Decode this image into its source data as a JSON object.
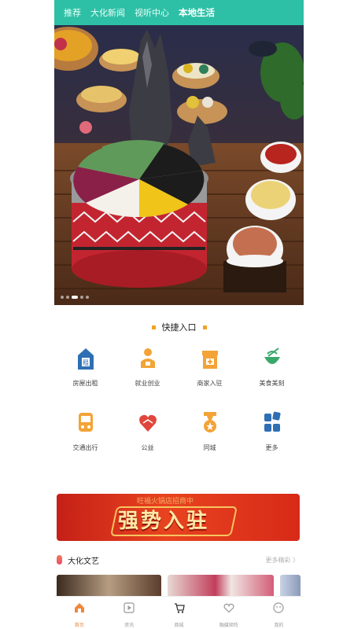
{
  "topnav": {
    "tabs": [
      "推荐",
      "大化新闻",
      "视听中心",
      "本地生活"
    ],
    "active_index": 3,
    "bg_color": "#2ec0a6"
  },
  "banner": {
    "dots_total": 5,
    "active_dot": 3
  },
  "quick_entry": {
    "title": "快捷入口",
    "items": [
      {
        "label": "房屋出租",
        "icon": "house-rent-icon"
      },
      {
        "label": "就业创业",
        "icon": "job-person-icon"
      },
      {
        "label": "商家入驻",
        "icon": "store-join-icon"
      },
      {
        "label": "美食美刻",
        "icon": "food-bowl-icon"
      },
      {
        "label": "交通出行",
        "icon": "bus-icon"
      },
      {
        "label": "公益",
        "icon": "charity-heart-icon"
      },
      {
        "label": "同城",
        "icon": "medal-icon"
      },
      {
        "label": "更多",
        "icon": "more-grid-icon"
      }
    ]
  },
  "ad_banner": {
    "sub_text": "旺福火锅店招商中",
    "main_text": "强势入驻"
  },
  "culture_section": {
    "title": "大化文艺",
    "more": "更多精彩 〉"
  },
  "tabbar": {
    "items": [
      {
        "label": "首页",
        "icon": "home-icon"
      },
      {
        "label": "资讯",
        "icon": "video-play-icon"
      },
      {
        "label": "商城",
        "icon": "shopping-cart-icon"
      },
      {
        "label": "融媒矩阵",
        "icon": "media-heart-icon"
      },
      {
        "label": "我的",
        "icon": "profile-icon"
      }
    ],
    "active_index": 0,
    "active_color": "#f0873a"
  }
}
